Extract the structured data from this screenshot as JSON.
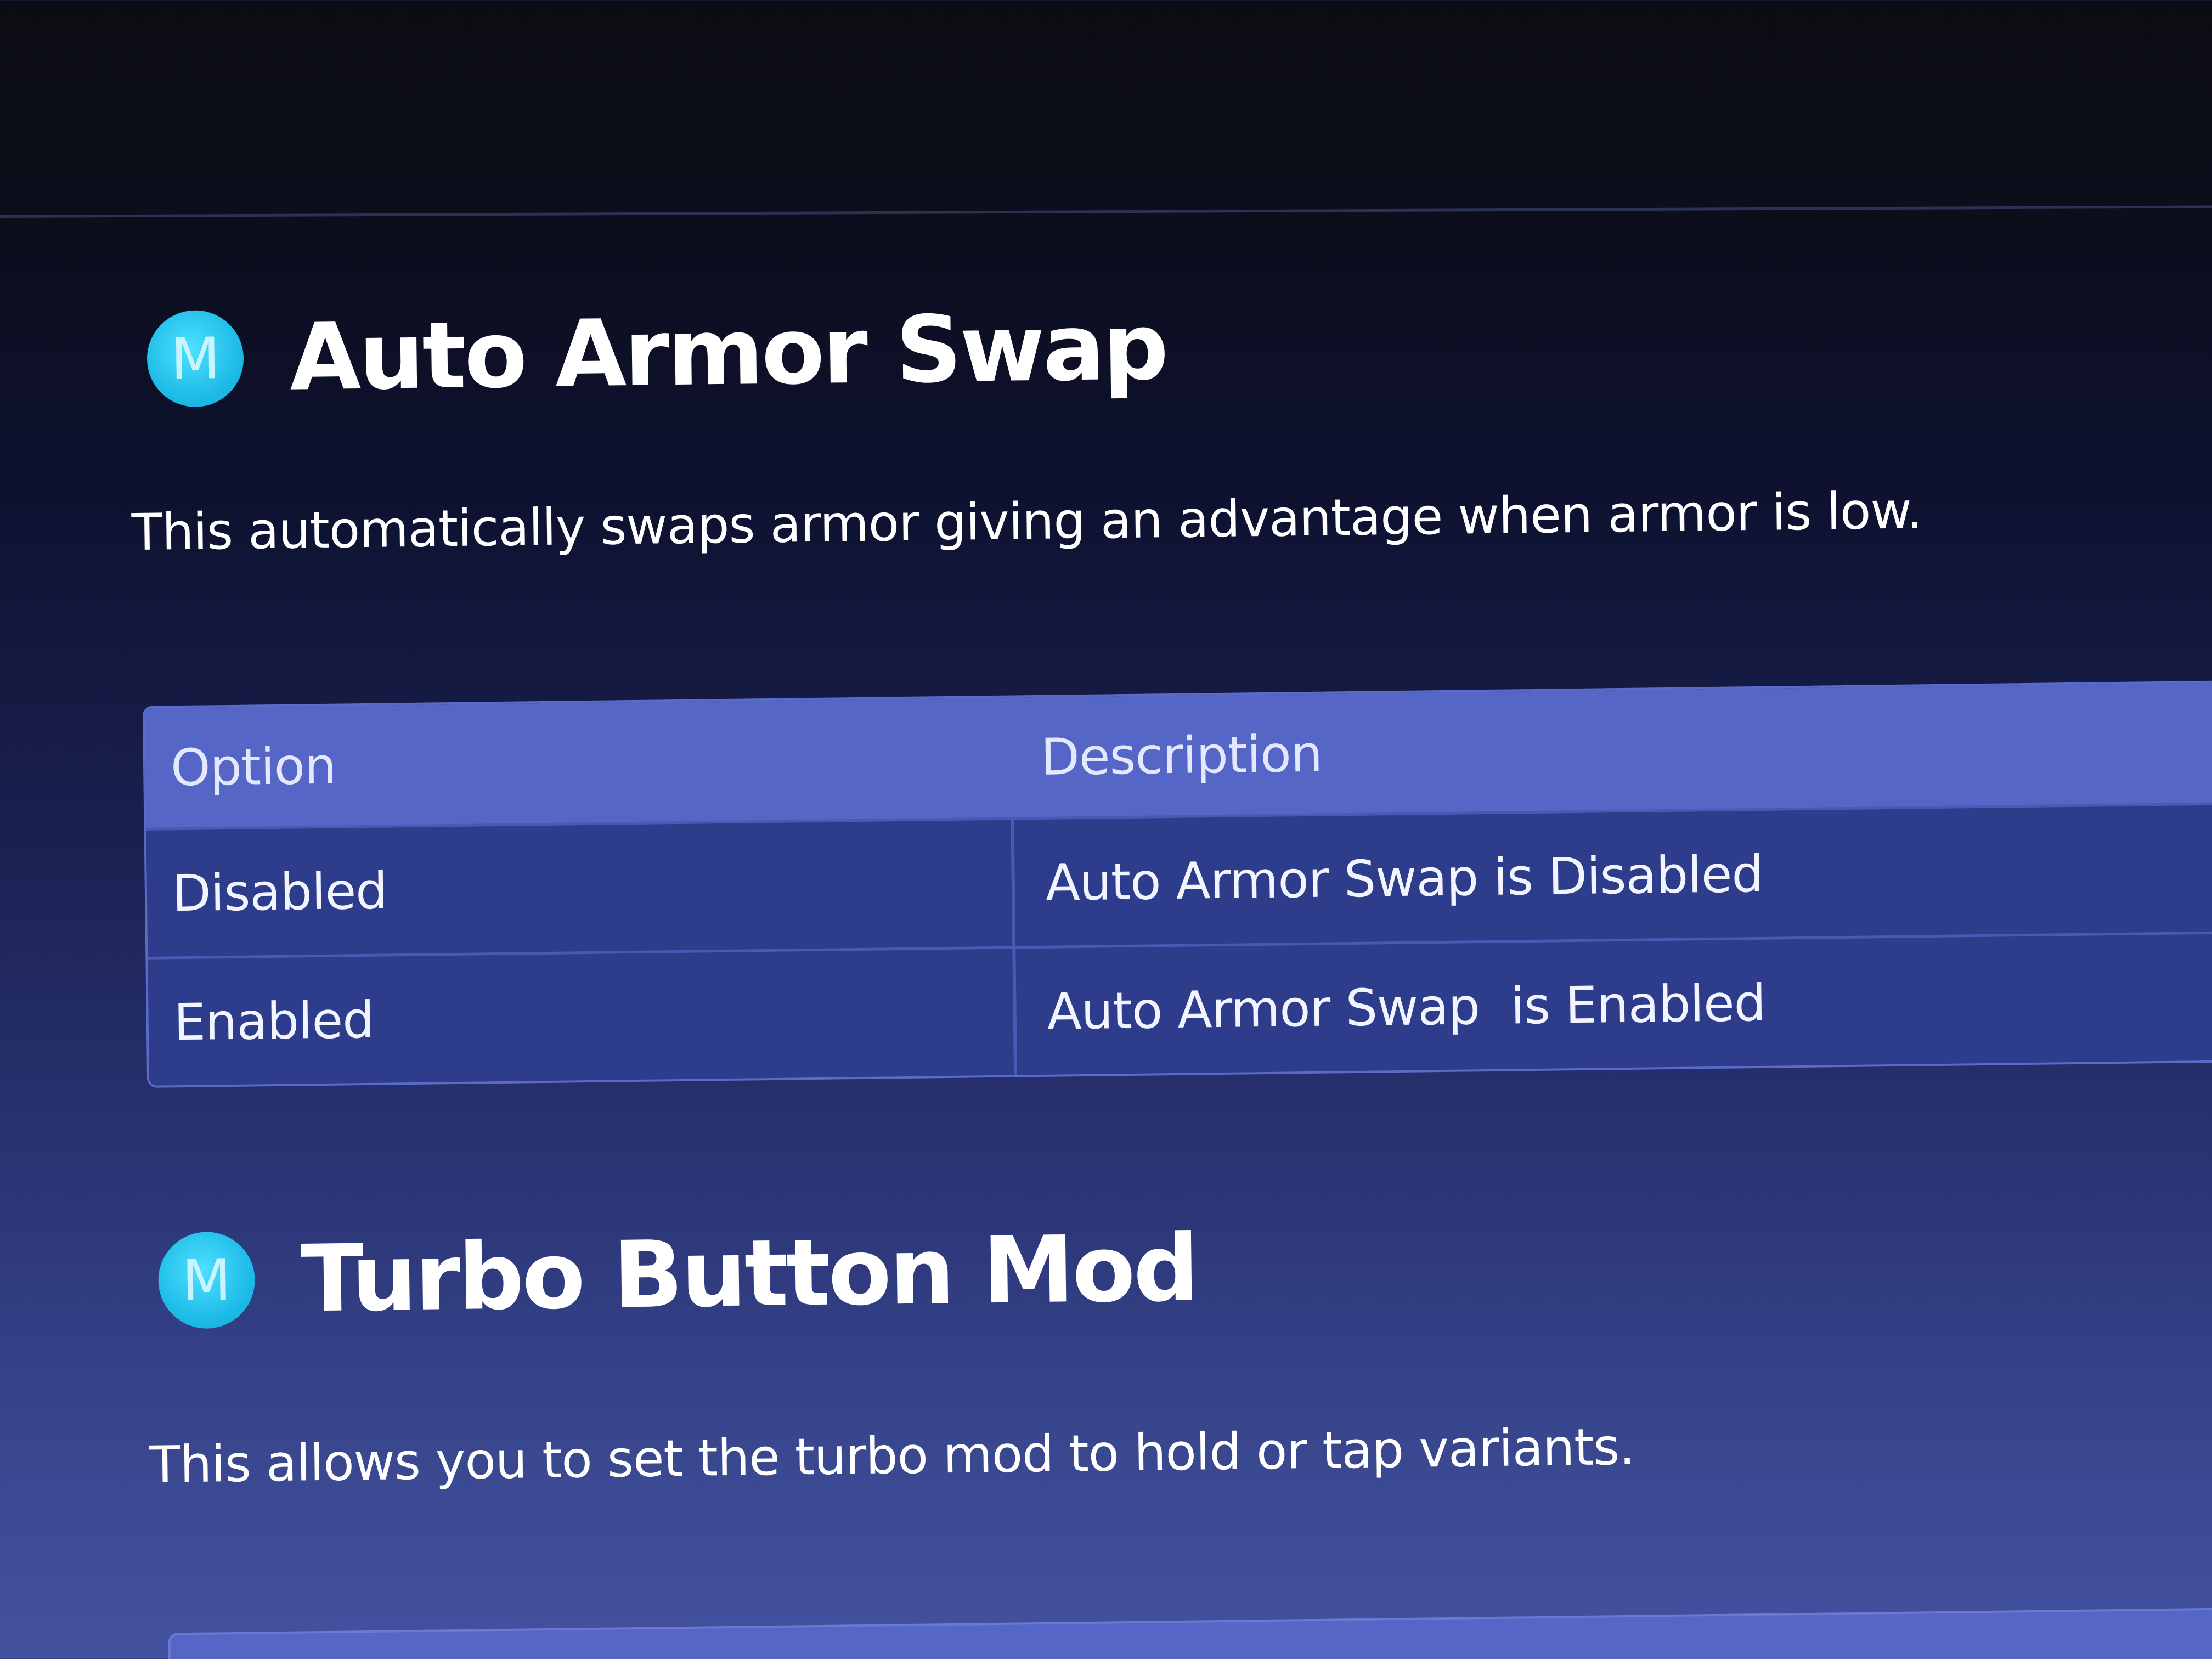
{
  "colors": {
    "badge": "#1fbde8",
    "table_header_bg": "#5566c6",
    "table_row_bg": "#2e3c8c"
  },
  "sections": [
    {
      "badge_letter": "M",
      "badge_icon": "m-circle-icon",
      "title": "Auto Armor Swap",
      "description": "This automatically swaps armor giving an advantage when armor is low.",
      "table": {
        "headers": [
          "Option",
          "Description"
        ],
        "rows": [
          [
            "Disabled",
            "Auto Armor Swap is Disabled"
          ],
          [
            "Enabled",
            "Auto Armor Swap  is Enabled"
          ]
        ]
      }
    },
    {
      "badge_letter": "M",
      "badge_icon": "m-circle-icon",
      "title": "Turbo Button Mod",
      "description": "This allows you to set the turbo mod to hold or tap variants."
    }
  ]
}
